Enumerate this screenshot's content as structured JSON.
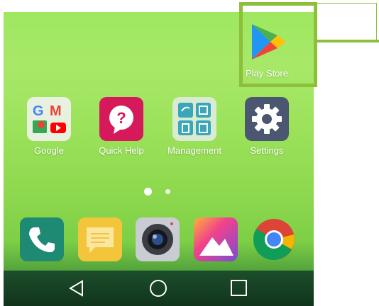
{
  "home_screen": {
    "top_apps": [
      {
        "label": "Play Store",
        "icon": "play-store-icon"
      }
    ],
    "apps": [
      {
        "label": "Google",
        "icon": "google-folder-icon"
      },
      {
        "label": "Quick Help",
        "icon": "quick-help-icon"
      },
      {
        "label": "Management",
        "icon": "management-folder-icon"
      },
      {
        "label": "Settings",
        "icon": "settings-gear-icon"
      }
    ],
    "page_indicator": {
      "pages": 2,
      "current": 1
    },
    "dock": [
      {
        "icon": "phone-icon"
      },
      {
        "icon": "messaging-icon"
      },
      {
        "icon": "camera-icon"
      },
      {
        "icon": "gallery-icon"
      },
      {
        "icon": "chrome-icon"
      }
    ]
  },
  "nav_bar": {
    "buttons": [
      {
        "icon": "back-triangle-icon"
      },
      {
        "icon": "home-circle-icon"
      },
      {
        "icon": "recents-square-icon"
      }
    ]
  },
  "colors": {
    "highlight": "#8cbf3a",
    "wallpaper_top": "#9ee860",
    "wallpaper_bottom": "#1c4f2a"
  }
}
